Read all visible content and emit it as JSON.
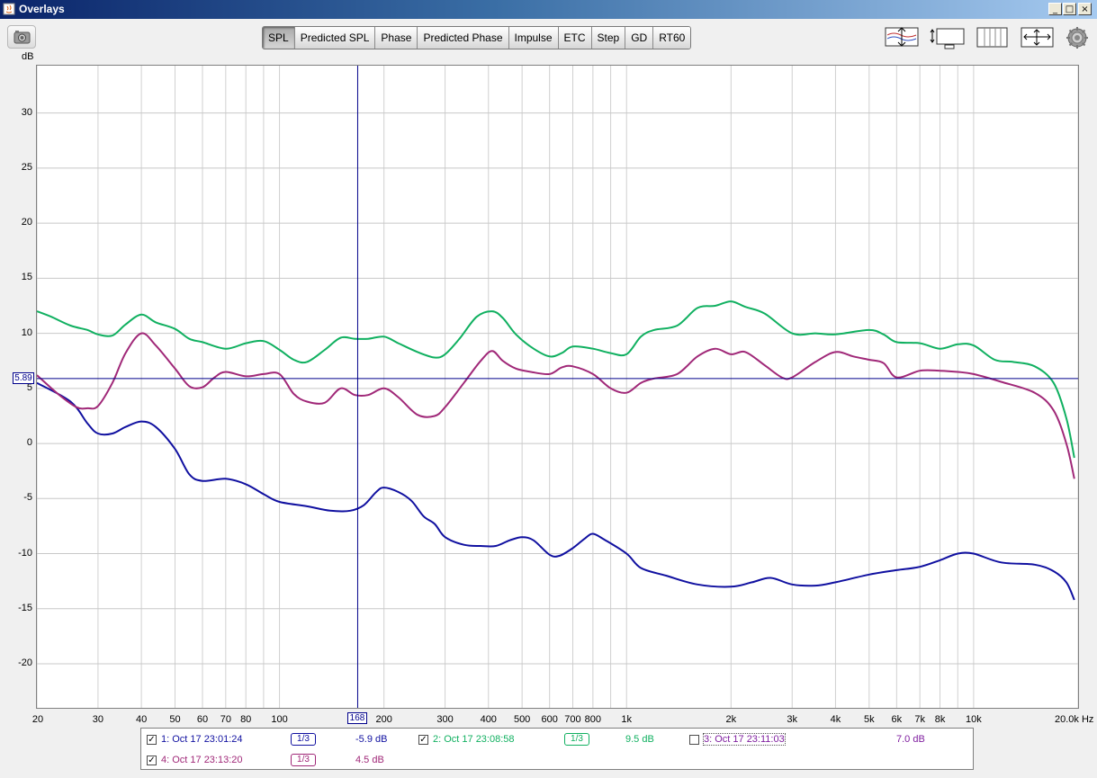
{
  "window": {
    "title": "Overlays",
    "controls": [
      "_",
      "□",
      "×"
    ]
  },
  "toolbar": {
    "tabs": [
      "SPL",
      "Predicted SPL",
      "Phase",
      "Predicted Phase",
      "Impulse",
      "ETC",
      "Step",
      "GD",
      "RT60"
    ],
    "active_tab": "SPL",
    "right_icons": [
      "vertical-scale-icon",
      "graph-limits-icon",
      "grid-spacing-icon",
      "pan-zoom-icon",
      "settings-gear-icon"
    ],
    "left_icon": "camera-icon"
  },
  "cursor": {
    "y_value": "5.89",
    "x_value": "168"
  },
  "legend": [
    {
      "number": "1",
      "name": "1: Oct 17 23:01:24",
      "checked": true,
      "smoothing": "1/3",
      "value": "-5.9 dB",
      "color": "#1010a0"
    },
    {
      "number": "2",
      "name": "2: Oct 17 23:08:58",
      "checked": true,
      "smoothing": "1/3",
      "value": "9.5 dB",
      "color": "#10b060"
    },
    {
      "number": "3",
      "name": "3: Oct 17 23:11:03",
      "checked": false,
      "smoothing": "",
      "value": "7.0 dB",
      "color": "#8020a0"
    },
    {
      "number": "4",
      "name": "4: Oct 17 23:13:20",
      "checked": true,
      "smoothing": "1/3",
      "value": "4.5 dB",
      "color": "#a02878"
    }
  ],
  "chart_data": {
    "type": "line",
    "xscale": "log",
    "xlim": [
      20,
      20000
    ],
    "ylim": [
      -24,
      34.3
    ],
    "ylabel": "dB",
    "xunit": "Hz",
    "yticks": [
      30,
      25,
      20,
      15,
      10,
      5,
      0,
      -5,
      -10,
      -15,
      -20
    ],
    "xticks": [
      {
        "v": 20,
        "label": "20"
      },
      {
        "v": 30,
        "label": "30"
      },
      {
        "v": 40,
        "label": "40"
      },
      {
        "v": 50,
        "label": "50"
      },
      {
        "v": 60,
        "label": "60"
      },
      {
        "v": 70,
        "label": "70"
      },
      {
        "v": 80,
        "label": "80"
      },
      {
        "v": 100,
        "label": "100"
      },
      {
        "v": 200,
        "label": "200"
      },
      {
        "v": 300,
        "label": "300"
      },
      {
        "v": 400,
        "label": "400"
      },
      {
        "v": 500,
        "label": "500"
      },
      {
        "v": 600,
        "label": "600"
      },
      {
        "v": 700,
        "label": "700"
      },
      {
        "v": 800,
        "label": "800"
      },
      {
        "v": 1000,
        "label": "1k"
      },
      {
        "v": 2000,
        "label": "2k"
      },
      {
        "v": 3000,
        "label": "3k"
      },
      {
        "v": 4000,
        "label": "4k"
      },
      {
        "v": 5000,
        "label": "5k"
      },
      {
        "v": 6000,
        "label": "6k"
      },
      {
        "v": 7000,
        "label": "7k"
      },
      {
        "v": 8000,
        "label": "8k"
      },
      {
        "v": 10000,
        "label": "10k"
      },
      {
        "v": 20000,
        "label": "20.0k Hz"
      }
    ],
    "cursor_x": 168,
    "cursor_y": 5.89,
    "grid": true,
    "series": [
      {
        "name": "1: Oct 17 23:01:24",
        "color": "#1010a0",
        "points": [
          [
            20,
            5.5
          ],
          [
            25,
            3.8
          ],
          [
            28,
            1.8
          ],
          [
            30,
            0.9
          ],
          [
            33,
            0.9
          ],
          [
            36,
            1.5
          ],
          [
            40,
            2.0
          ],
          [
            44,
            1.5
          ],
          [
            50,
            -0.5
          ],
          [
            55,
            -2.8
          ],
          [
            60,
            -3.4
          ],
          [
            70,
            -3.2
          ],
          [
            80,
            -3.7
          ],
          [
            90,
            -4.6
          ],
          [
            100,
            -5.3
          ],
          [
            120,
            -5.7
          ],
          [
            140,
            -6.1
          ],
          [
            160,
            -6.1
          ],
          [
            175,
            -5.6
          ],
          [
            190,
            -4.4
          ],
          [
            200,
            -4.0
          ],
          [
            220,
            -4.4
          ],
          [
            240,
            -5.2
          ],
          [
            260,
            -6.6
          ],
          [
            280,
            -7.3
          ],
          [
            300,
            -8.5
          ],
          [
            340,
            -9.2
          ],
          [
            380,
            -9.3
          ],
          [
            420,
            -9.3
          ],
          [
            460,
            -8.8
          ],
          [
            500,
            -8.5
          ],
          [
            540,
            -8.8
          ],
          [
            600,
            -10.1
          ],
          [
            640,
            -10.2
          ],
          [
            700,
            -9.5
          ],
          [
            760,
            -8.6
          ],
          [
            800,
            -8.2
          ],
          [
            860,
            -8.7
          ],
          [
            1000,
            -10.0
          ],
          [
            1100,
            -11.3
          ],
          [
            1300,
            -12.0
          ],
          [
            1600,
            -12.8
          ],
          [
            2000,
            -13.0
          ],
          [
            2300,
            -12.6
          ],
          [
            2600,
            -12.2
          ],
          [
            3000,
            -12.8
          ],
          [
            3500,
            -12.9
          ],
          [
            4000,
            -12.6
          ],
          [
            5000,
            -11.9
          ],
          [
            6000,
            -11.5
          ],
          [
            7000,
            -11.2
          ],
          [
            8000,
            -10.6
          ],
          [
            9000,
            -10.0
          ],
          [
            10000,
            -10.0
          ],
          [
            12000,
            -10.8
          ],
          [
            15000,
            -11.0
          ],
          [
            17000,
            -11.6
          ],
          [
            18500,
            -12.6
          ],
          [
            19500,
            -14.2
          ]
        ]
      },
      {
        "name": "2: Oct 17 23:08:58",
        "color": "#10b060",
        "points": [
          [
            20,
            12.0
          ],
          [
            22,
            11.5
          ],
          [
            25,
            10.7
          ],
          [
            28,
            10.3
          ],
          [
            30,
            9.9
          ],
          [
            33,
            9.8
          ],
          [
            36,
            10.8
          ],
          [
            40,
            11.7
          ],
          [
            44,
            11.0
          ],
          [
            50,
            10.4
          ],
          [
            55,
            9.5
          ],
          [
            60,
            9.2
          ],
          [
            70,
            8.6
          ],
          [
            80,
            9.1
          ],
          [
            90,
            9.3
          ],
          [
            100,
            8.5
          ],
          [
            110,
            7.6
          ],
          [
            120,
            7.4
          ],
          [
            135,
            8.5
          ],
          [
            150,
            9.6
          ],
          [
            165,
            9.5
          ],
          [
            180,
            9.5
          ],
          [
            200,
            9.7
          ],
          [
            220,
            9.1
          ],
          [
            250,
            8.3
          ],
          [
            280,
            7.8
          ],
          [
            300,
            8.1
          ],
          [
            330,
            9.5
          ],
          [
            370,
            11.5
          ],
          [
            410,
            12.0
          ],
          [
            440,
            11.4
          ],
          [
            480,
            9.9
          ],
          [
            540,
            8.6
          ],
          [
            600,
            7.9
          ],
          [
            650,
            8.2
          ],
          [
            700,
            8.8
          ],
          [
            800,
            8.6
          ],
          [
            900,
            8.2
          ],
          [
            1000,
            8.1
          ],
          [
            1100,
            9.7
          ],
          [
            1200,
            10.3
          ],
          [
            1400,
            10.7
          ],
          [
            1600,
            12.3
          ],
          [
            1800,
            12.5
          ],
          [
            2000,
            12.9
          ],
          [
            2200,
            12.4
          ],
          [
            2500,
            11.8
          ],
          [
            3000,
            10.0
          ],
          [
            3500,
            10.0
          ],
          [
            4000,
            9.9
          ],
          [
            5000,
            10.3
          ],
          [
            5500,
            9.9
          ],
          [
            6000,
            9.2
          ],
          [
            7000,
            9.1
          ],
          [
            8000,
            8.6
          ],
          [
            9000,
            9.0
          ],
          [
            10000,
            8.9
          ],
          [
            11500,
            7.6
          ],
          [
            13000,
            7.4
          ],
          [
            15000,
            7.0
          ],
          [
            17000,
            5.5
          ],
          [
            18500,
            2.3
          ],
          [
            19500,
            -1.3
          ]
        ]
      },
      {
        "name": "4: Oct 17 23:13:20",
        "color": "#a02878",
        "points": [
          [
            20,
            6.2
          ],
          [
            23,
            4.5
          ],
          [
            26,
            3.3
          ],
          [
            28,
            3.2
          ],
          [
            30,
            3.4
          ],
          [
            33,
            5.5
          ],
          [
            36,
            8.2
          ],
          [
            40,
            10.0
          ],
          [
            44,
            8.9
          ],
          [
            50,
            6.8
          ],
          [
            55,
            5.2
          ],
          [
            60,
            5.1
          ],
          [
            65,
            6.0
          ],
          [
            70,
            6.5
          ],
          [
            80,
            6.1
          ],
          [
            90,
            6.3
          ],
          [
            100,
            6.3
          ],
          [
            110,
            4.5
          ],
          [
            120,
            3.8
          ],
          [
            135,
            3.7
          ],
          [
            150,
            5.0
          ],
          [
            165,
            4.4
          ],
          [
            180,
            4.4
          ],
          [
            200,
            5.0
          ],
          [
            220,
            4.2
          ],
          [
            250,
            2.6
          ],
          [
            280,
            2.5
          ],
          [
            300,
            3.3
          ],
          [
            340,
            5.5
          ],
          [
            380,
            7.5
          ],
          [
            410,
            8.4
          ],
          [
            440,
            7.5
          ],
          [
            480,
            6.8
          ],
          [
            530,
            6.5
          ],
          [
            600,
            6.3
          ],
          [
            650,
            6.9
          ],
          [
            700,
            7.0
          ],
          [
            800,
            6.3
          ],
          [
            900,
            5.0
          ],
          [
            1000,
            4.6
          ],
          [
            1100,
            5.5
          ],
          [
            1200,
            5.9
          ],
          [
            1400,
            6.3
          ],
          [
            1600,
            7.9
          ],
          [
            1800,
            8.6
          ],
          [
            2000,
            8.1
          ],
          [
            2200,
            8.3
          ],
          [
            2500,
            7.1
          ],
          [
            2800,
            6.0
          ],
          [
            3000,
            6.0
          ],
          [
            3500,
            7.4
          ],
          [
            4000,
            8.3
          ],
          [
            4500,
            7.9
          ],
          [
            5000,
            7.6
          ],
          [
            5500,
            7.3
          ],
          [
            6000,
            6.0
          ],
          [
            7000,
            6.6
          ],
          [
            8000,
            6.6
          ],
          [
            9000,
            6.5
          ],
          [
            10000,
            6.3
          ],
          [
            12000,
            5.6
          ],
          [
            15000,
            4.6
          ],
          [
            17000,
            3.0
          ],
          [
            18500,
            0.0
          ],
          [
            19500,
            -3.2
          ]
        ]
      }
    ]
  }
}
